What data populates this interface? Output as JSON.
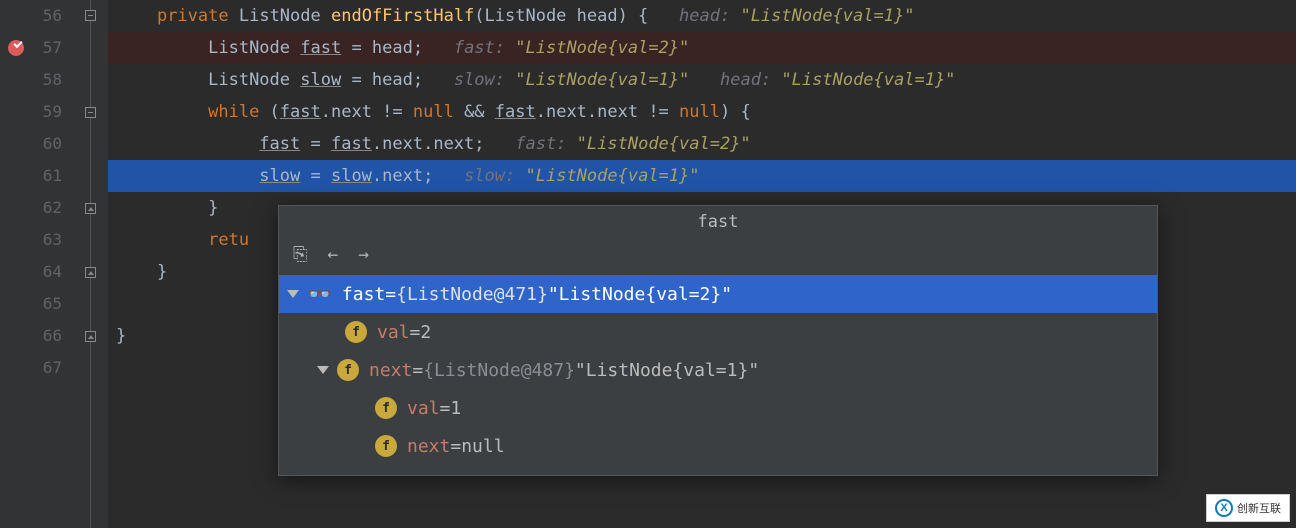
{
  "gutter": [
    "56",
    "57",
    "58",
    "59",
    "60",
    "61",
    "62",
    "63",
    "64",
    "65",
    "66",
    "67"
  ],
  "code": {
    "l56": {
      "kw": "private",
      "type": "ListNode",
      "method": "endOfFirstHalf",
      "params": "(ListNode head) {",
      "hint_label": "head:",
      "hint_val": "\"ListNode{val=1}\""
    },
    "l57": {
      "type": "ListNode",
      "var": "fast",
      "eq": " = head;",
      "hint_label": "fast:",
      "hint_val": "\"ListNode{val=2}\""
    },
    "l58": {
      "type": "ListNode",
      "var": "slow",
      "eq": " = head;",
      "hint1_label": "slow:",
      "hint1_val": "\"ListNode{val=1}\"",
      "hint2_label": "head:",
      "hint2_val": "\"ListNode{val=1}\""
    },
    "l59": {
      "kw": "while",
      "cond1": " (",
      "var1": "fast",
      "p1": ".next != ",
      "kw2": "null",
      "p2": " && ",
      "var2": "fast",
      "p3": ".next.next != ",
      "kw3": "null",
      "p4": ") {"
    },
    "l60": {
      "var1": "fast",
      "eq": " = ",
      "var2": "fast",
      "rest": ".next.next;",
      "hint_label": "fast:",
      "hint_val": "\"ListNode{val=2}\""
    },
    "l61": {
      "var1": "slow",
      "eq": " = ",
      "var2": "slow",
      "rest": ".next;",
      "hint_label": "slow:",
      "hint_val": "\"ListNode{val=1}\""
    },
    "l62": {
      "brace": "}"
    },
    "l63": {
      "kw": "retu"
    },
    "l64": {
      "brace": "}"
    },
    "l66": {
      "brace": "}"
    }
  },
  "popup": {
    "title": "fast",
    "row1": {
      "name": "fast",
      "eq": " = ",
      "type": "{ListNode@471} ",
      "str": "\"ListNode{val=2}\""
    },
    "row2": {
      "name": "val",
      "eq": " = ",
      "val": "2"
    },
    "row3": {
      "name": "next",
      "eq": " = ",
      "type": "{ListNode@487} ",
      "str": "\"ListNode{val=1}\""
    },
    "row4": {
      "name": "val",
      "eq": " = ",
      "val": "1"
    },
    "row5": {
      "name": "next",
      "eq": " = ",
      "val": "null"
    }
  },
  "watermark": {
    "text": "创新互联"
  }
}
